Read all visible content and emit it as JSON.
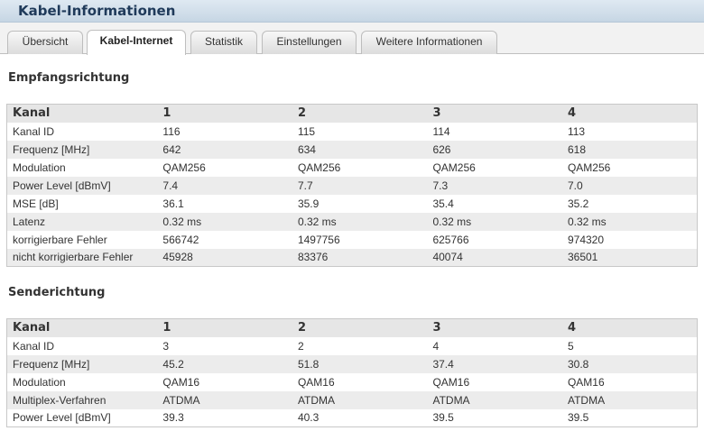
{
  "window": {
    "title": "Kabel-Informationen"
  },
  "tabs": [
    {
      "label": "Übersicht",
      "active": false
    },
    {
      "label": "Kabel-Internet",
      "active": true
    },
    {
      "label": "Statistik",
      "active": false
    },
    {
      "label": "Einstellungen",
      "active": false
    },
    {
      "label": "Weitere Informationen",
      "active": false
    }
  ],
  "downstream": {
    "title": "Empfangsrichtung",
    "header": [
      "Kanal",
      "1",
      "2",
      "3",
      "4"
    ],
    "rows": [
      [
        "Kanal ID",
        "116",
        "115",
        "114",
        "113"
      ],
      [
        "Frequenz [MHz]",
        "642",
        "634",
        "626",
        "618"
      ],
      [
        "Modulation",
        "QAM256",
        "QAM256",
        "QAM256",
        "QAM256"
      ],
      [
        "Power Level [dBmV]",
        "7.4",
        "7.7",
        "7.3",
        "7.0"
      ],
      [
        "MSE [dB]",
        "36.1",
        "35.9",
        "35.4",
        "35.2"
      ],
      [
        "Latenz",
        "0.32 ms",
        "0.32 ms",
        "0.32 ms",
        "0.32 ms"
      ],
      [
        "korrigierbare Fehler",
        "566742",
        "1497756",
        "625766",
        "974320"
      ],
      [
        "nicht korrigierbare Fehler",
        "45928",
        "83376",
        "40074",
        "36501"
      ]
    ]
  },
  "upstream": {
    "title": "Senderichtung",
    "header": [
      "Kanal",
      "1",
      "2",
      "3",
      "4"
    ],
    "rows": [
      [
        "Kanal ID",
        "3",
        "2",
        "4",
        "5"
      ],
      [
        "Frequenz [MHz]",
        "45.2",
        "51.8",
        "37.4",
        "30.8"
      ],
      [
        "Modulation",
        "QAM16",
        "QAM16",
        "QAM16",
        "QAM16"
      ],
      [
        "Multiplex-Verfahren",
        "ATDMA",
        "ATDMA",
        "ATDMA",
        "ATDMA"
      ],
      [
        "Power Level [dBmV]",
        "39.3",
        "40.3",
        "39.5",
        "39.5"
      ]
    ]
  }
}
